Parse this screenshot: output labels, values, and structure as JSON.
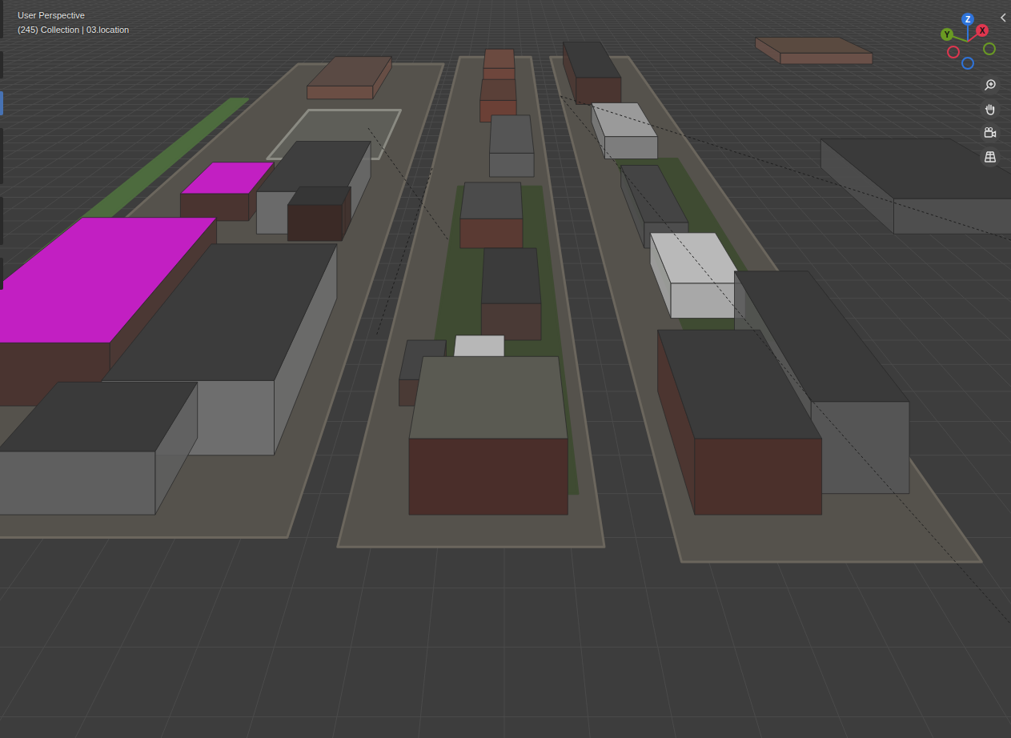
{
  "viewport": {
    "mode": "User Perspective",
    "info": "(245) Collection | 03.location"
  },
  "gizmo": {
    "axes": [
      {
        "label": "Z",
        "color": "#2f74db"
      },
      {
        "label": "Y",
        "color": "#6a9a23"
      },
      {
        "label": "X",
        "color": "#e0364f"
      }
    ]
  }
}
